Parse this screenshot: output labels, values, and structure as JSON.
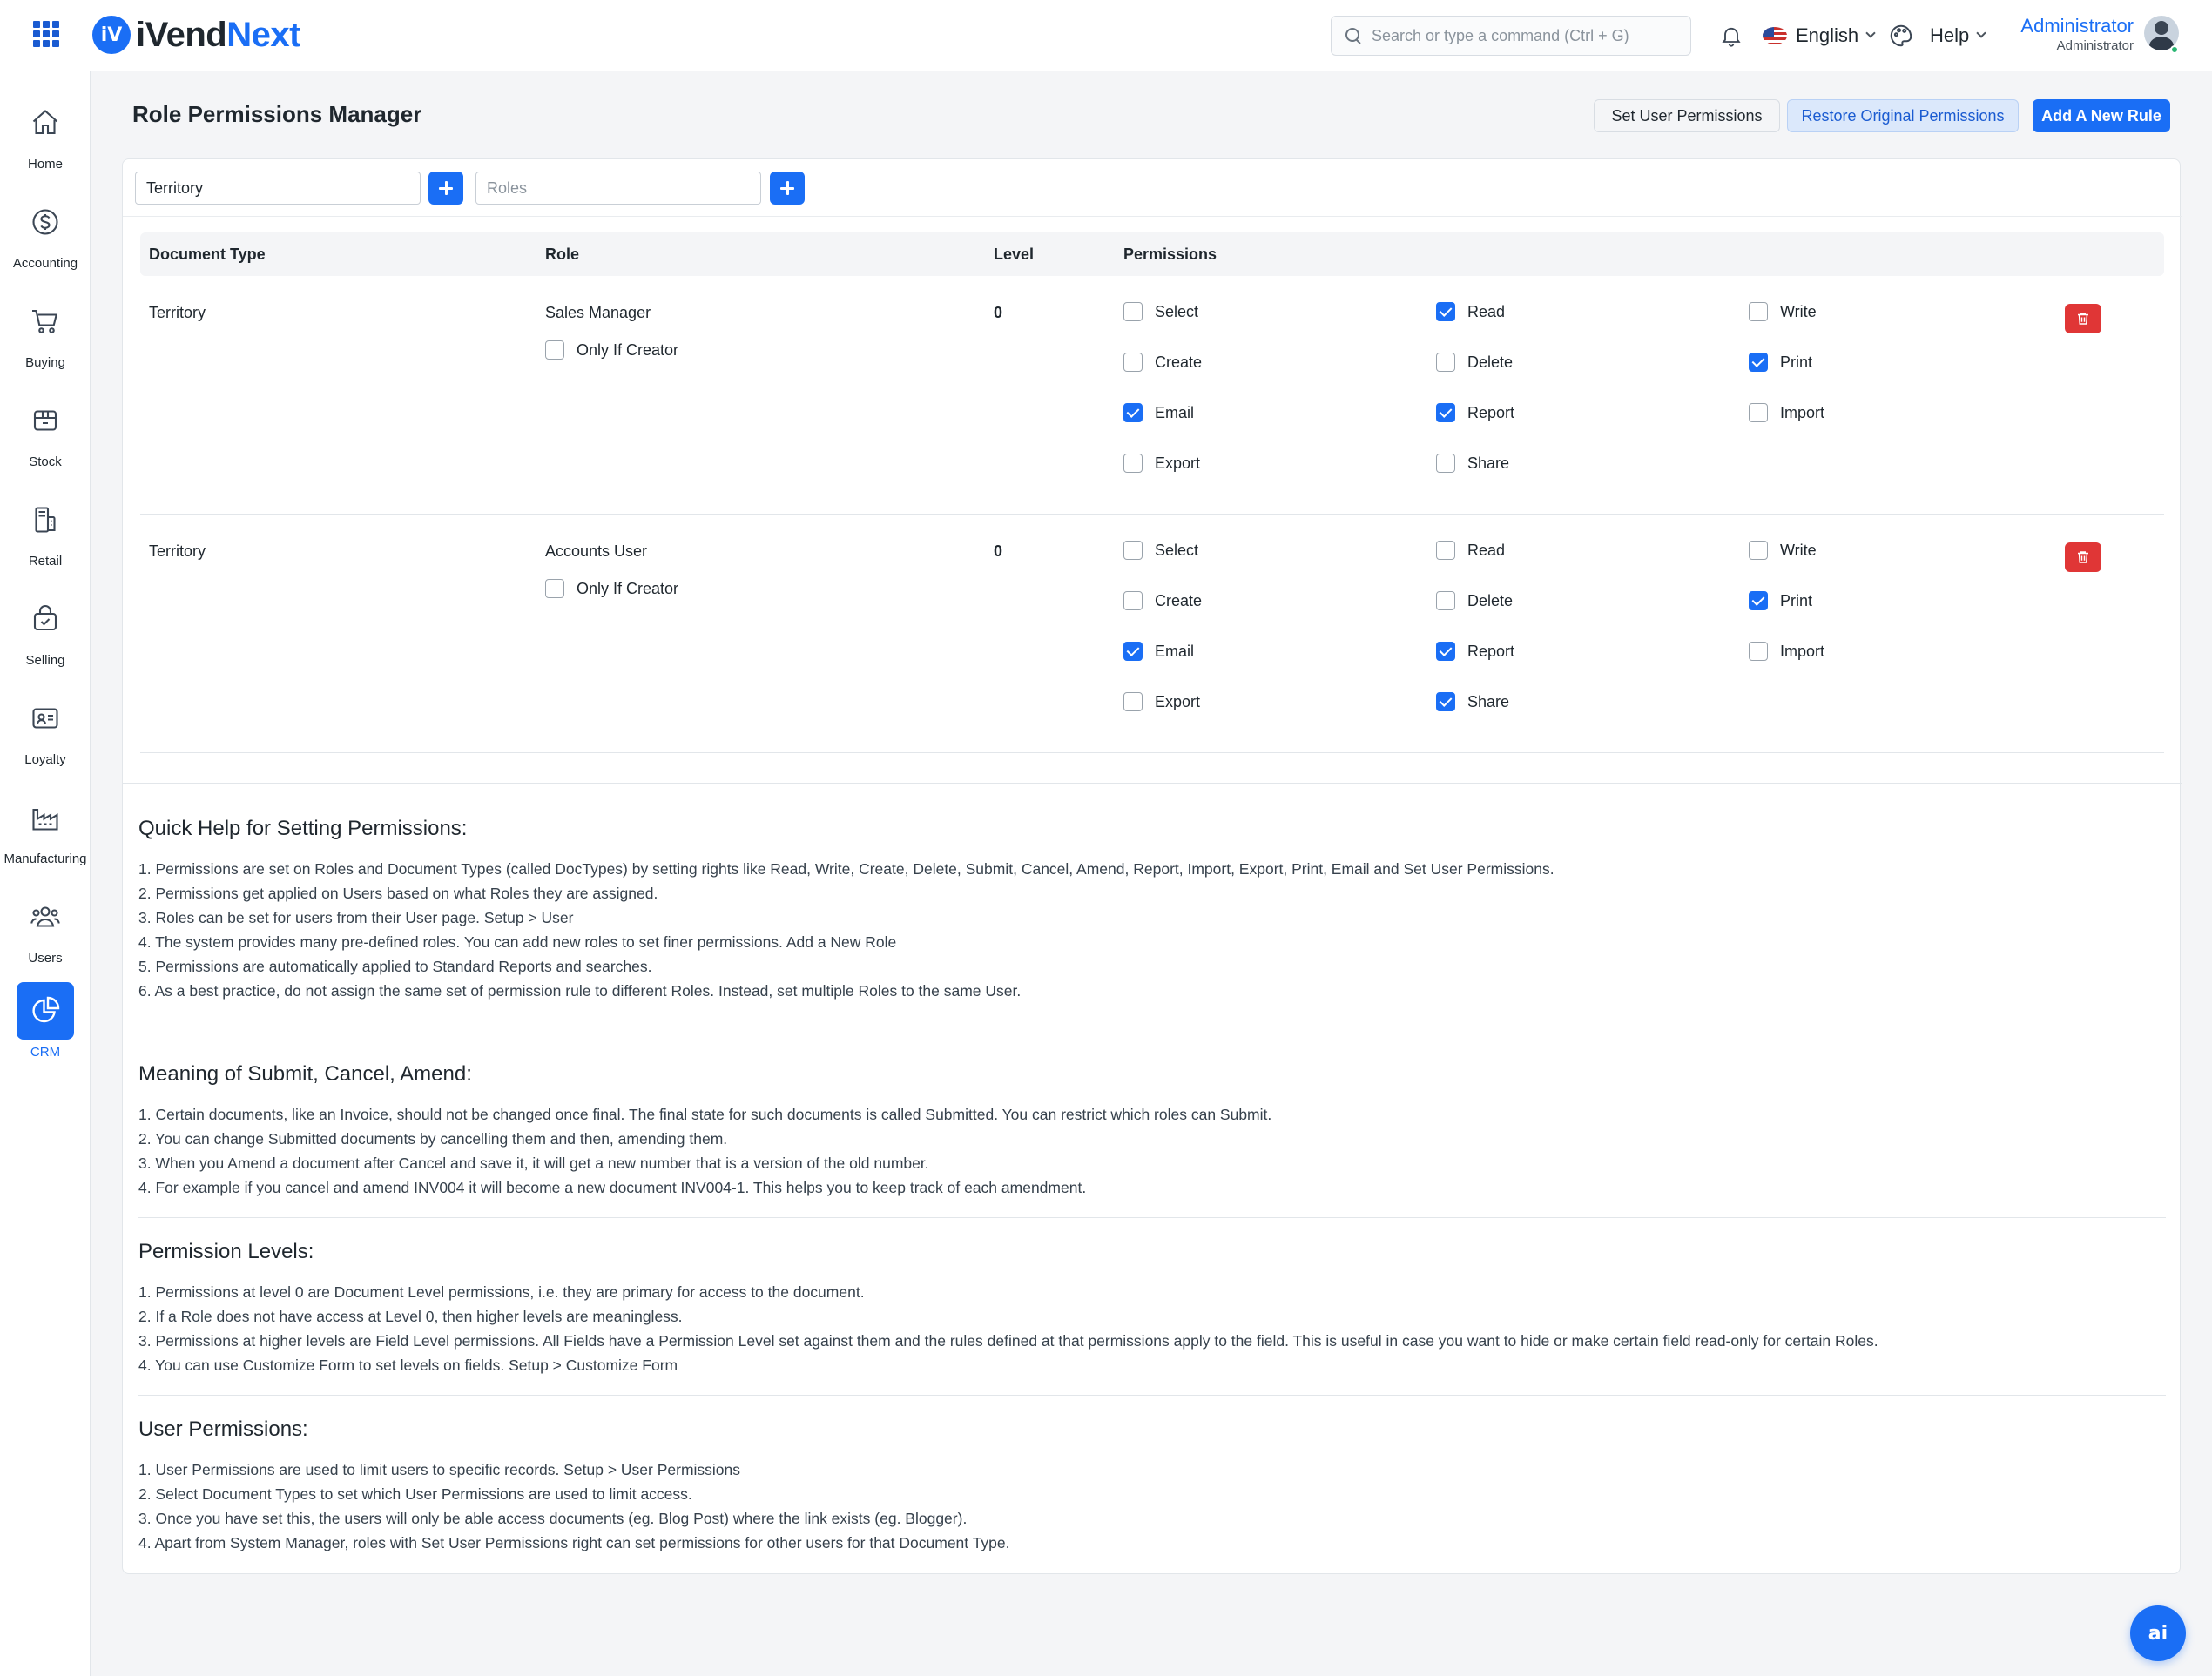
{
  "brand": {
    "logo_mark": "iV",
    "name_part1": "iVend",
    "name_part2": "Next",
    "accent": "#1a6ef5"
  },
  "header": {
    "search_placeholder": "Search or type a command (Ctrl + G)",
    "language": "English",
    "help": "Help",
    "user_name": "Administrator",
    "user_role": "Administrator"
  },
  "sidebar": {
    "items": [
      {
        "label": "Home",
        "icon": "home-icon"
      },
      {
        "label": "Accounting",
        "icon": "dollar-icon"
      },
      {
        "label": "Buying",
        "icon": "cart-icon"
      },
      {
        "label": "Stock",
        "icon": "box-icon"
      },
      {
        "label": "Retail",
        "icon": "pos-icon"
      },
      {
        "label": "Selling",
        "icon": "shopping-bag-icon"
      },
      {
        "label": "Loyalty",
        "icon": "id-card-icon"
      },
      {
        "label": "Manufacturing",
        "icon": "factory-icon"
      },
      {
        "label": "Users",
        "icon": "users-icon"
      },
      {
        "label": "CRM",
        "icon": "pie-chart-icon",
        "active": true
      }
    ]
  },
  "page": {
    "title": "Role Permissions Manager",
    "buttons": {
      "set_user_permissions": "Set User Permissions",
      "restore": "Restore Original Permissions",
      "add_rule": "Add A New Rule"
    },
    "filters": {
      "doctype_value": "Territory",
      "roles_placeholder": "Roles"
    }
  },
  "table": {
    "headers": {
      "doctype": "Document Type",
      "role": "Role",
      "level": "Level",
      "permissions": "Permissions"
    },
    "only_if_creator_label": "Only If Creator",
    "rules": [
      {
        "doctype": "Territory",
        "role": "Sales Manager",
        "level": "0",
        "only_if_creator": false,
        "permissions": [
          {
            "label": "Select",
            "checked": false
          },
          {
            "label": "Read",
            "checked": true
          },
          {
            "label": "Write",
            "checked": false
          },
          {
            "label": "Create",
            "checked": false
          },
          {
            "label": "Delete",
            "checked": false
          },
          {
            "label": "Print",
            "checked": true
          },
          {
            "label": "Email",
            "checked": true
          },
          {
            "label": "Report",
            "checked": true
          },
          {
            "label": "Import",
            "checked": false
          },
          {
            "label": "Export",
            "checked": false
          },
          {
            "label": "Share",
            "checked": false
          }
        ]
      },
      {
        "doctype": "Territory",
        "role": "Accounts User",
        "level": "0",
        "only_if_creator": false,
        "permissions": [
          {
            "label": "Select",
            "checked": false
          },
          {
            "label": "Read",
            "checked": false
          },
          {
            "label": "Write",
            "checked": false
          },
          {
            "label": "Create",
            "checked": false
          },
          {
            "label": "Delete",
            "checked": false
          },
          {
            "label": "Print",
            "checked": true
          },
          {
            "label": "Email",
            "checked": true
          },
          {
            "label": "Report",
            "checked": true
          },
          {
            "label": "Import",
            "checked": false
          },
          {
            "label": "Export",
            "checked": false
          },
          {
            "label": "Share",
            "checked": true
          }
        ]
      }
    ]
  },
  "help": [
    {
      "title": "Quick Help for Setting Permissions:",
      "items": [
        "1. Permissions are set on Roles and Document Types (called DocTypes) by setting rights like Read, Write, Create, Delete, Submit, Cancel, Amend, Report, Import, Export, Print, Email and Set User Permissions.",
        "2. Permissions get applied on Users based on what Roles they are assigned.",
        "3. Roles can be set for users from their User page. Setup > User",
        "4. The system provides many pre-defined roles. You can add new roles to set finer permissions. Add a New Role",
        "5. Permissions are automatically applied to Standard Reports and searches.",
        "6. As a best practice, do not assign the same set of permission rule to different Roles. Instead, set multiple Roles to the same User."
      ]
    },
    {
      "title": "Meaning of Submit, Cancel, Amend:",
      "items": [
        "1. Certain documents, like an Invoice, should not be changed once final. The final state for such documents is called Submitted. You can restrict which roles can Submit.",
        "2. You can change Submitted documents by cancelling them and then, amending them.",
        "3. When you Amend a document after Cancel and save it, it will get a new number that is a version of the old number.",
        "4. For example if you cancel and amend INV004 it will become a new document INV004-1. This helps you to keep track of each amendment."
      ]
    },
    {
      "title": "Permission Levels:",
      "items": [
        "1. Permissions at level 0 are Document Level permissions, i.e. they are primary for access to the document.",
        "2. If a Role does not have access at Level 0, then higher levels are meaningless.",
        "3. Permissions at higher levels are Field Level permissions. All Fields have a Permission Level set against them and the rules defined at that permissions apply to the field. This is useful in case you want to hide or make certain field read-only for certain Roles.",
        "4. You can use Customize Form to set levels on fields. Setup > Customize Form"
      ]
    },
    {
      "title": "User Permissions:",
      "items": [
        "1. User Permissions are used to limit users to specific records. Setup > User Permissions",
        "2. Select Document Types to set which User Permissions are used to limit access.",
        "3. Once you have set this, the users will only be able access documents (eg. Blog Post) where the link exists (eg. Blogger).",
        "4. Apart from System Manager, roles with Set User Permissions right can set permissions for other users for that Document Type."
      ]
    }
  ],
  "fab": {
    "label": "ai"
  }
}
